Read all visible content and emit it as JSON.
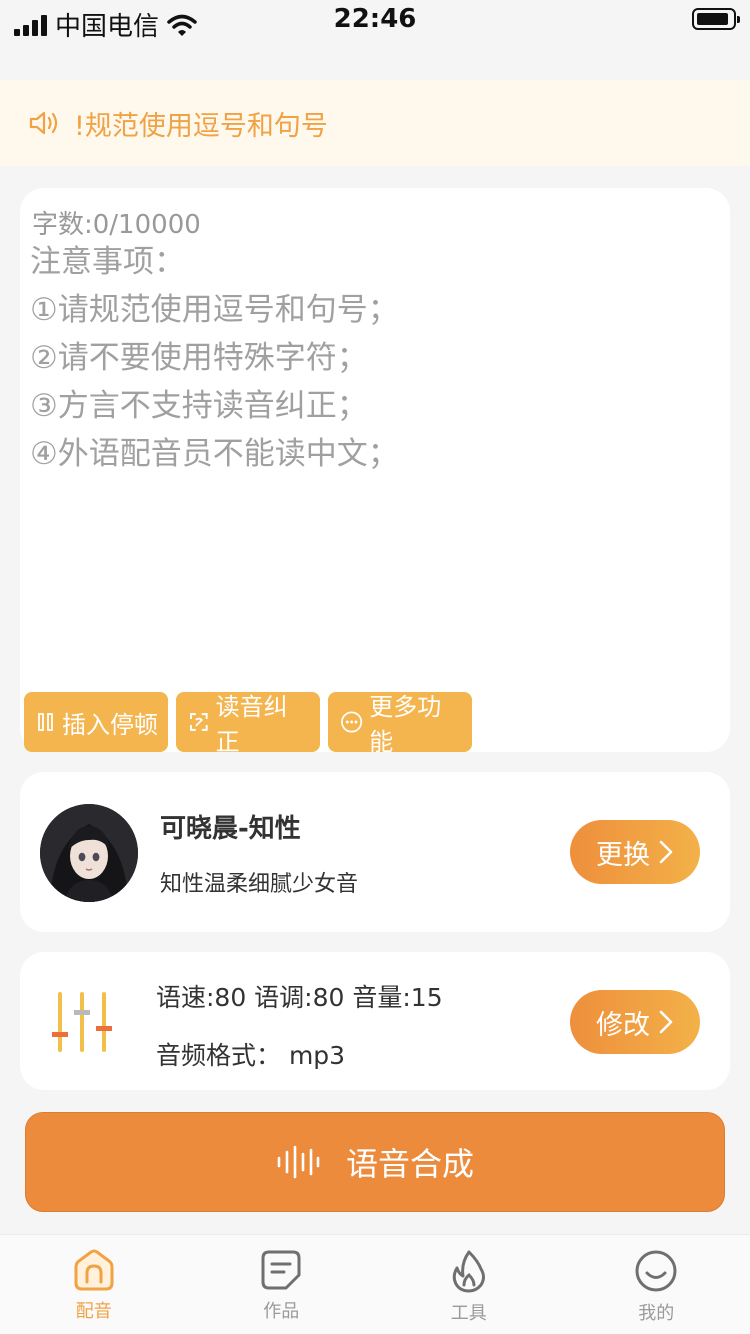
{
  "status": {
    "carrier": "中国电信",
    "time": "22:46"
  },
  "notice": {
    "text": "!规范使用逗号和句号"
  },
  "editor": {
    "word_count": "字数:0/10000",
    "notes": [
      "注意事项：",
      "①请规范使用逗号和句号；",
      "②请不要使用特殊字符；",
      "③方言不支持读音纠正；",
      "④外语配音员不能读中文；"
    ],
    "tools": {
      "insert_pause": "插入停顿",
      "pronunciation": "读音纠正",
      "more": "更多功能"
    }
  },
  "voice": {
    "name": "可晓晨-知性",
    "desc": "知性温柔细腻少女音",
    "change_label": "更换"
  },
  "settings": {
    "line1": "语速:80 语调:80 音量:15",
    "line2": "音频格式：  mp3",
    "modify_label": "修改"
  },
  "synth": {
    "label": "语音合成"
  },
  "tabbar": {
    "active_color": "#f0a244",
    "inactive_color": "#9a9a9a",
    "items": [
      "配音",
      "作品",
      "工具",
      "我的"
    ]
  }
}
